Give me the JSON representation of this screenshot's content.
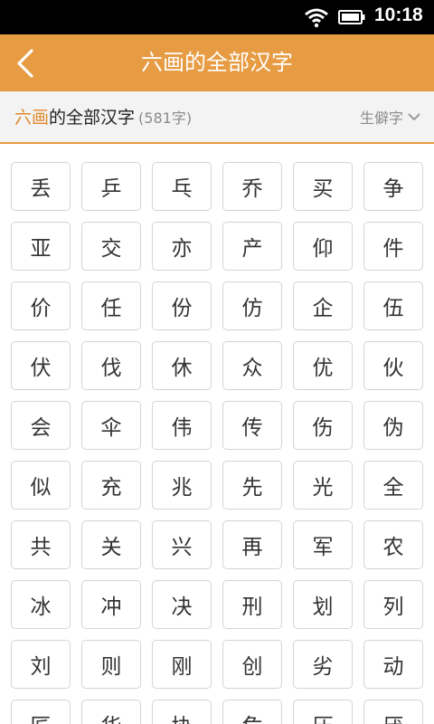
{
  "status_bar": {
    "time": "10:18"
  },
  "header": {
    "title": "六画的全部汉字"
  },
  "subheader": {
    "heading_highlight": "六画",
    "heading_rest": "的全部汉字",
    "count": "(581字)",
    "filter_label": "生僻字"
  },
  "colors": {
    "accent": "#e79b43",
    "highlight_text": "#e08a2c"
  },
  "characters": [
    "丢",
    "乒",
    "乓",
    "乔",
    "买",
    "争",
    "亚",
    "交",
    "亦",
    "产",
    "仰",
    "件",
    "价",
    "任",
    "份",
    "仿",
    "企",
    "伍",
    "伏",
    "伐",
    "休",
    "众",
    "优",
    "伙",
    "会",
    "伞",
    "伟",
    "传",
    "伤",
    "伪",
    "似",
    "充",
    "兆",
    "先",
    "光",
    "全",
    "共",
    "关",
    "兴",
    "再",
    "军",
    "农",
    "冰",
    "冲",
    "决",
    "刑",
    "划",
    "列",
    "刘",
    "则",
    "刚",
    "创",
    "劣",
    "动",
    "匠",
    "华",
    "协",
    "危",
    "压",
    "厌"
  ]
}
